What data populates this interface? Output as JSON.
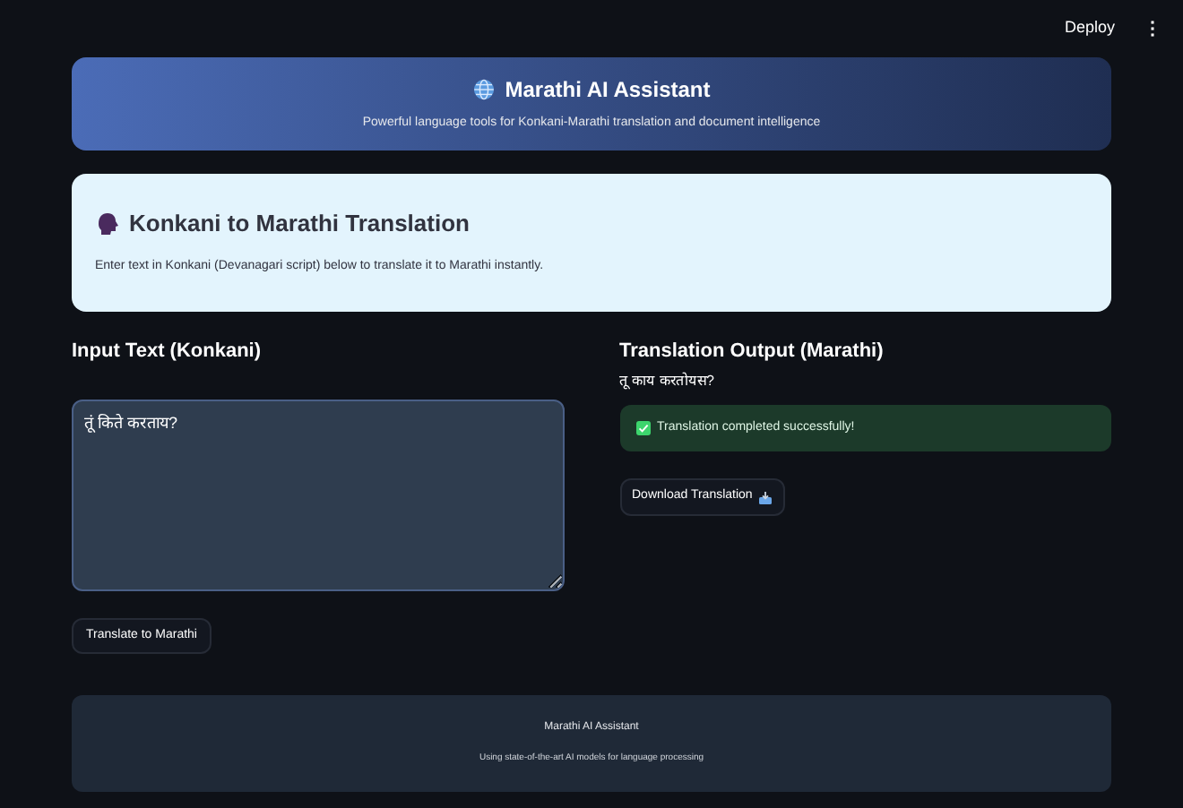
{
  "toolbar": {
    "deploy": "Deploy",
    "menu": "⋮"
  },
  "header": {
    "title": "Marathi AI Assistant",
    "subtitle": "Powerful language tools for Konkani-Marathi translation and document intelligence"
  },
  "intro": {
    "title": "Konkani to Marathi Translation",
    "text": "Enter text in Konkani (Devanagari script) below to translate it to Marathi instantly."
  },
  "input": {
    "heading": "Input Text (Konkani)",
    "value": "तूं किते करताय?",
    "button": "Translate to Marathi"
  },
  "output": {
    "heading": "Translation Output (Marathi)",
    "text": "तू काय करतोयस?",
    "status": {
      "text": "Translation completed successfully!",
      "checked": true
    },
    "button": "Download Translation"
  },
  "footer": {
    "title": "Marathi AI Assistant",
    "text": "Using state-of-the-art AI models for language processing"
  }
}
